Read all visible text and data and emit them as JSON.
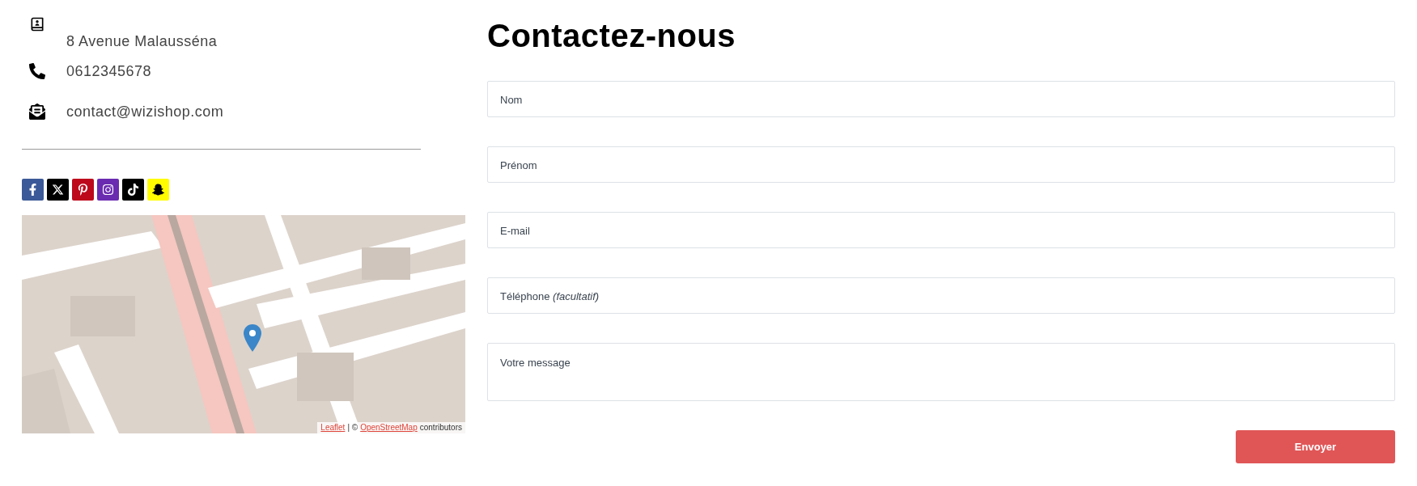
{
  "contact": [
    {
      "kind": "address",
      "text": "8 Avenue Malausséna"
    },
    {
      "kind": "phone",
      "text": "0612345678"
    },
    {
      "kind": "email",
      "text": "contact@wizishop.com"
    }
  ],
  "social": [
    {
      "kind": "facebook",
      "color": "#3b5998"
    },
    {
      "kind": "x",
      "color": "#000000"
    },
    {
      "kind": "pinterest",
      "color": "#bd081c"
    },
    {
      "kind": "instagram",
      "color": "#6a2bb0"
    },
    {
      "kind": "tiktok",
      "color": "#000000"
    },
    {
      "kind": "snapchat",
      "color": "#fffc00"
    }
  ],
  "map": {
    "kind": "picture",
    "attribution": [
      {
        "kind": "link",
        "text": "Leaflet"
      },
      {
        "kind": "text",
        "text": "| ©"
      },
      {
        "kind": "link",
        "text": "OpenStreetMap"
      },
      {
        "kind": "text",
        "text": "contributors"
      }
    ]
  },
  "form": {
    "title": "Contactez-nous",
    "fields": [
      {
        "kind": "input",
        "placeholder": "Nom"
      },
      {
        "kind": "input",
        "placeholder": "Prénom"
      },
      {
        "kind": "input",
        "placeholder": "E-mail"
      },
      {
        "kind": "input",
        "placeholder": "Téléphone *(facultatif)*"
      },
      {
        "kind": "textarea",
        "placeholder": "Votre message"
      }
    ],
    "submit": "Envoyer"
  }
}
